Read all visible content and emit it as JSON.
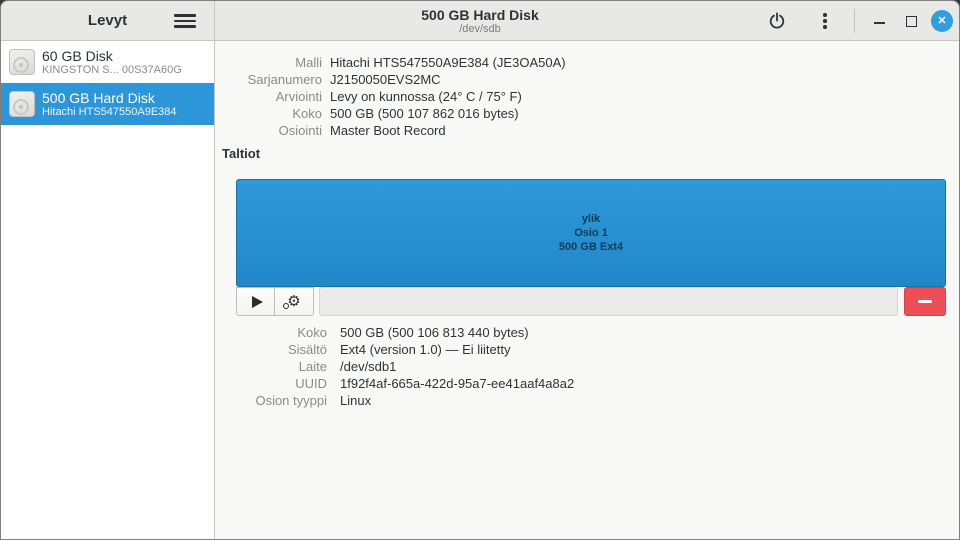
{
  "sidebar": {
    "title": "Levyt",
    "items": [
      {
        "title": "60 GB Disk",
        "subtitle": "KINGSTON S... 00S37A60G"
      },
      {
        "title": "500 GB Hard Disk",
        "subtitle": "Hitachi HTS547550A9E384"
      }
    ]
  },
  "header": {
    "title": "500 GB Hard Disk",
    "subtitle": "/dev/sdb"
  },
  "drive_info": {
    "rows": [
      {
        "label": "Malli",
        "value": "Hitachi HTS547550A9E384 (JE3OA50A)"
      },
      {
        "label": "Sarjanumero",
        "value": "J2150050EVS2MC"
      },
      {
        "label": "Arviointi",
        "value": "Levy on kunnossa (24° C / 75° F)"
      },
      {
        "label": "Koko",
        "value": "500 GB (500 107 862 016 bytes)"
      },
      {
        "label": "Osiointi",
        "value": "Master Boot Record"
      }
    ]
  },
  "volumes": {
    "section_title": "Taltiot",
    "partition": {
      "name": "ylik",
      "label": "Osio 1",
      "size": "500 GB Ext4"
    }
  },
  "volume_info": {
    "rows": [
      {
        "label": "Koko",
        "value": "500 GB (500 106 813 440 bytes)"
      },
      {
        "label": "Sisältö",
        "value": "Ext4 (version 1.0) — Ei liitetty"
      },
      {
        "label": "Laite",
        "value": "/dev/sdb1"
      },
      {
        "label": "UUID",
        "value": "1f92f4af-665a-422d-95a7-ee41aaf4a8a2"
      },
      {
        "label": "Osion tyyppi",
        "value": "Linux"
      }
    ]
  },
  "icons": {
    "gear_glyph": "⚙",
    "close_glyph": "✕"
  },
  "colors": {
    "accent_selection": "#2d96d8",
    "volume_fill_top": "#2e99d9",
    "volume_fill_bottom": "#2187c8",
    "destructive_red": "#ee4f56",
    "close_button_blue": "#2f9fdd"
  }
}
